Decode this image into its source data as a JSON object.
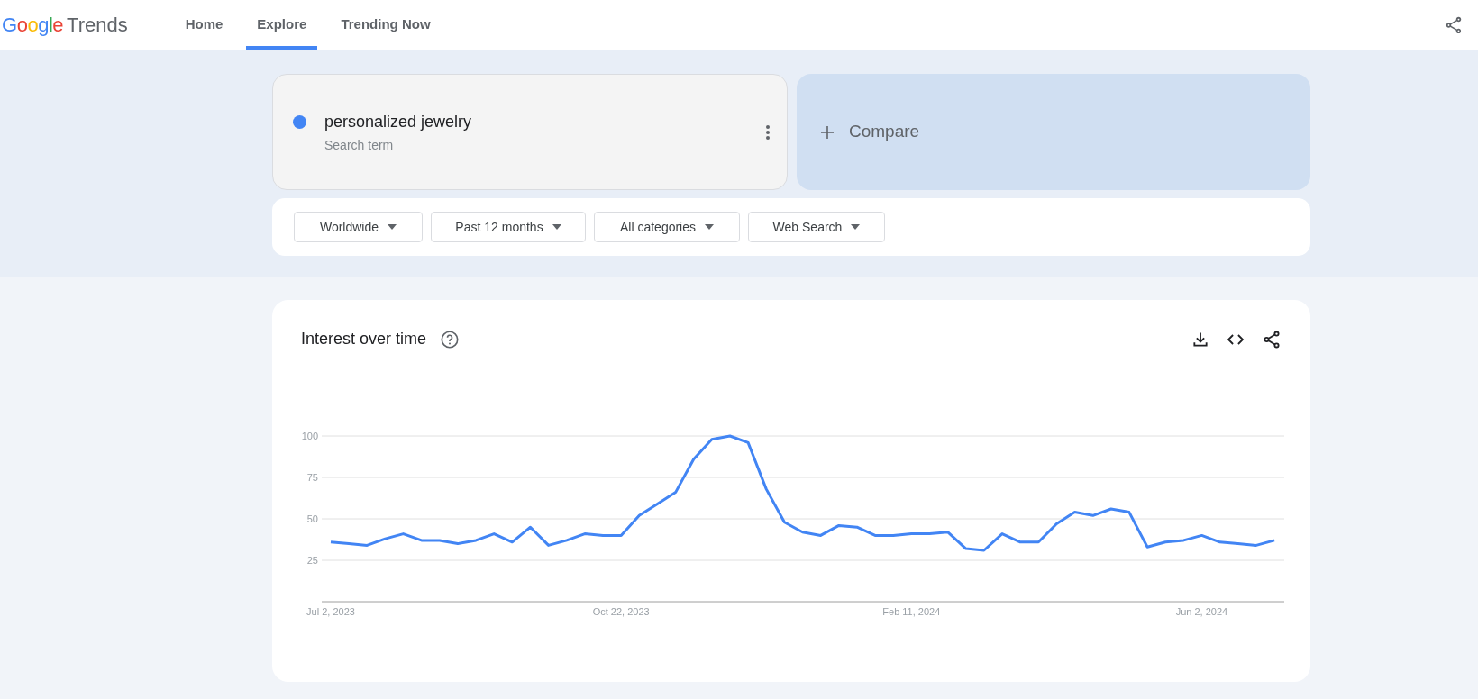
{
  "header": {
    "logo_brand": "Google",
    "logo_product": "Trends",
    "nav": [
      {
        "label": "Home",
        "selected": false
      },
      {
        "label": "Explore",
        "selected": true
      },
      {
        "label": "Trending Now",
        "selected": false
      }
    ]
  },
  "search_terms": [
    {
      "term": "personalized jewelry",
      "subtitle": "Search term",
      "color": "#4285f4"
    }
  ],
  "compare": {
    "label": "Compare"
  },
  "filters": [
    {
      "label": "Worldwide"
    },
    {
      "label": "Past 12 months"
    },
    {
      "label": "All categories"
    },
    {
      "label": "Web Search"
    }
  ],
  "interest_over_time": {
    "title": "Interest over time",
    "chart_data": {
      "type": "line",
      "grid": true,
      "ylim": [
        0,
        100
      ],
      "categories": [
        "Jul 2, 2023",
        null,
        null,
        null,
        null,
        null,
        null,
        null,
        null,
        null,
        null,
        null,
        null,
        null,
        null,
        null,
        "Oct 22, 2023",
        null,
        null,
        null,
        null,
        null,
        null,
        null,
        null,
        null,
        null,
        null,
        null,
        null,
        null,
        null,
        "Feb 11, 2024",
        null,
        null,
        null,
        null,
        null,
        null,
        null,
        null,
        null,
        null,
        null,
        null,
        null,
        null,
        null,
        "Jun 2, 2024",
        null,
        null,
        null,
        null
      ],
      "yticks": [
        25,
        50,
        75,
        100
      ],
      "series": [
        {
          "color": "#4285f4",
          "values": [
            36,
            35,
            34,
            38,
            41,
            37,
            37,
            35,
            37,
            41,
            36,
            45,
            34,
            37,
            41,
            40,
            40,
            52,
            59,
            66,
            86,
            98,
            100,
            96,
            68,
            48,
            42,
            40,
            46,
            45,
            40,
            40,
            41,
            41,
            42,
            32,
            31,
            41,
            36,
            36,
            47,
            54,
            52,
            56,
            54,
            33,
            36,
            37,
            40,
            36,
            35,
            34,
            37
          ]
        }
      ]
    }
  }
}
